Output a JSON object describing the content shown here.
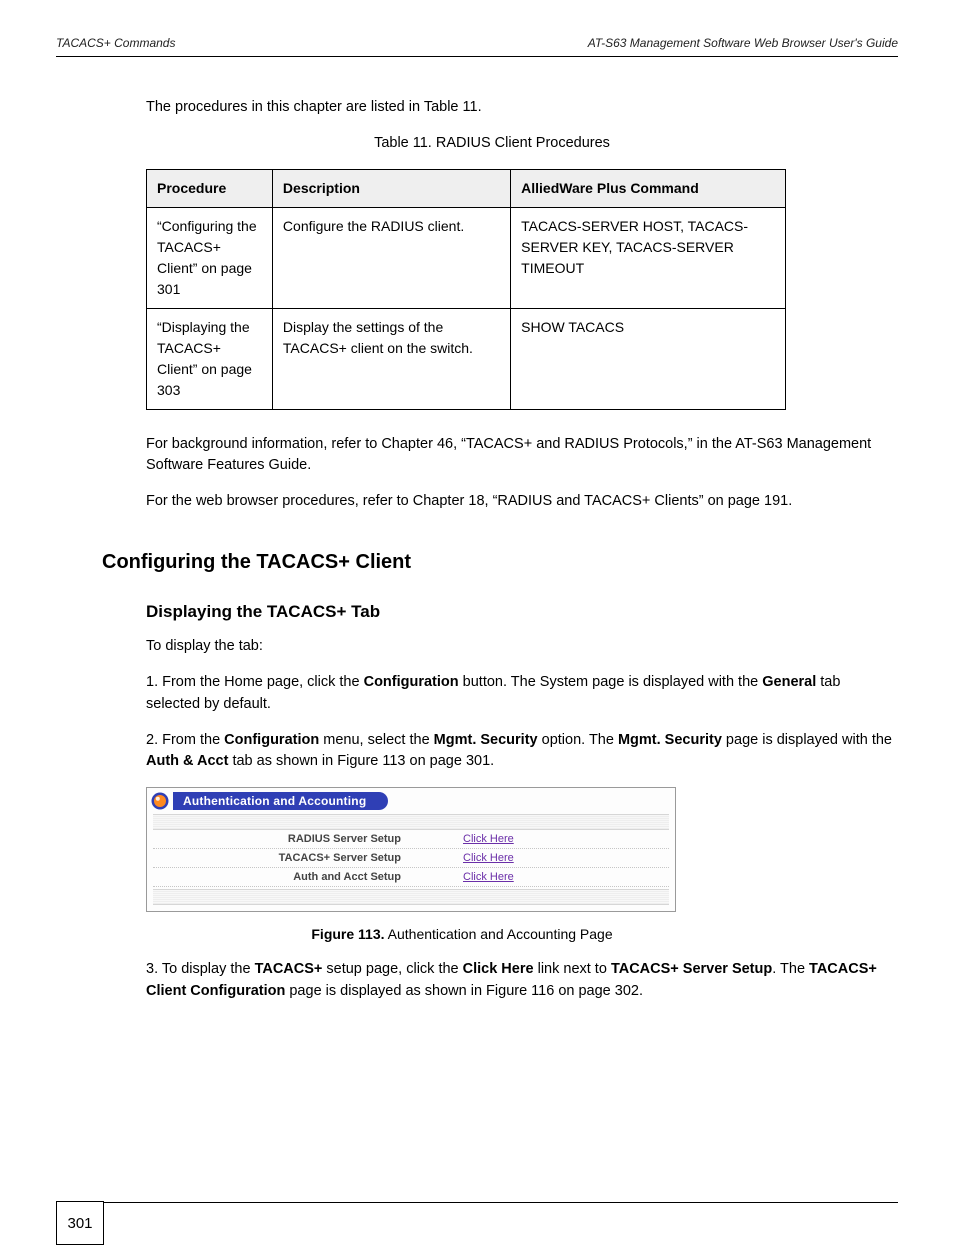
{
  "header": {
    "left": "TACACS+ Commands",
    "right": "AT-S63 Management Software Web Browser User's Guide"
  },
  "intro": {
    "p1_prefix": "The procedures in this chapter are listed in ",
    "p1_link": "Table 11",
    "p1_suffix": ".",
    "table_label": "Table 11. RADIUS Client Procedures"
  },
  "table": {
    "headers": [
      "Procedure",
      "Description",
      "AlliedWare Plus Command"
    ],
    "rows": [
      {
        "procedure": "“Configuring the TACACS+ Client” on page 301",
        "description": "Configure the RADIUS client.",
        "command": "TACACS-SERVER HOST, TACACS-SERVER KEY, TACACS-SERVER TIMEOUT"
      },
      {
        "procedure": "“Displaying the TACACS+ Client” on page 303",
        "description": "Display the settings of the TACACS+ client on the switch.",
        "command": "SHOW TACACS"
      }
    ]
  },
  "post_table": {
    "p1": "For background information, refer to Chapter 46, “TACACS+ and RADIUS Protocols,” in the AT-S63 Management Software Features Guide.",
    "p2_prefix": "For the web browser procedures, refer to ",
    "p2_link": "Chapter 18, “RADIUS and TACACS+ Clients” on page 191",
    "p2_suffix": "."
  },
  "sections": {
    "main": "Configuring the TACACS+ Client",
    "sub": "Displaying the TACACS+ Tab",
    "lead_in": "To display the tab:",
    "step1_prefix": "1.    From the Home page, click the ",
    "step1_bold1": "Configuration",
    "step1_mid": " button. The System page is displayed with the ",
    "step1_bold2": "General",
    "step1_suffix": " tab selected by default.",
    "step2_prefix": "2.    From the ",
    "step2_bold1": "Configuration",
    "step2_mid1": " menu, select the ",
    "step2_bold2": "Mgmt. Security",
    "step2_mid2": " option. The ",
    "step2_bold3": "Mgmt. Security",
    "step2_mid3": " page is displayed with the ",
    "step2_bold4": "Auth & Acct",
    "step2_suffix": " tab as shown in Figure 113 on page 301.",
    "fig_label": "Figure 113.",
    "fig_caption": " Authentication and Accounting Page"
  },
  "panel": {
    "title": "Authentication and Accounting",
    "rows": [
      {
        "label": "RADIUS Server Setup",
        "link": "Click Here"
      },
      {
        "label": "TACACS+ Server Setup",
        "link": "Click Here"
      },
      {
        "label": "Auth and Acct Setup",
        "link": "Click Here"
      }
    ]
  },
  "after_panel": {
    "step3_prefix": "3.    To display the ",
    "step3_bold1": "TACACS+",
    "step3_mid1": " setup page, click the ",
    "step3_bold2": "Click Here",
    "step3_mid2": " link next to ",
    "step3_bold3": "TACACS+ Server Setup",
    "step3_mid3": ". The ",
    "step3_bold4": "TACACS+ Client Configuration",
    "step3_suffix": " page is displayed as shown in Figure 116 on page 302."
  },
  "footer": {
    "page": "301"
  }
}
